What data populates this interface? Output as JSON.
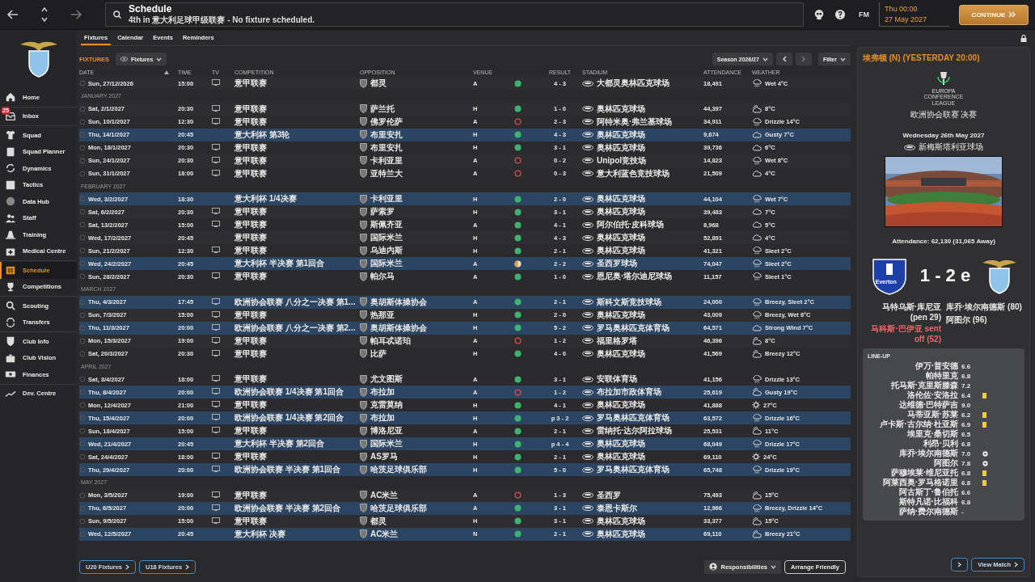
{
  "top_bar": {
    "title": "Schedule",
    "subtitle": "4th in 意大利足球甲级联赛 - No fixture scheduled.",
    "brand": "FM",
    "time": "Thu 00:00",
    "date": "27 May 2027",
    "continue_button": "CONTINUE"
  },
  "sidebar": {
    "groups": [
      {
        "items": [
          {
            "label": "Home",
            "selected": false
          }
        ]
      },
      {
        "items": [
          {
            "label": "Inbox",
            "badge": "25",
            "selected": false
          }
        ]
      },
      {
        "items": [
          {
            "label": "Squad",
            "selected": false
          },
          {
            "label": "Squad Planner",
            "selected": false
          },
          {
            "label": "Dynamics",
            "selected": false
          },
          {
            "label": "Tactics",
            "selected": false
          },
          {
            "label": "Data Hub",
            "selected": false
          },
          {
            "label": "Staff",
            "selected": false
          },
          {
            "label": "Training",
            "selected": false
          },
          {
            "label": "Medical Centre",
            "selected": false
          }
        ]
      },
      {
        "items": [
          {
            "label": "Schedule",
            "selected": true
          },
          {
            "label": "Competitions",
            "selected": false
          }
        ]
      },
      {
        "items": [
          {
            "label": "Scouting",
            "selected": false
          },
          {
            "label": "Transfers",
            "selected": false
          }
        ]
      },
      {
        "items": [
          {
            "label": "Club Info",
            "selected": false
          },
          {
            "label": "Club Vision",
            "selected": false
          },
          {
            "label": "Finances",
            "selected": false
          }
        ]
      },
      {
        "items": [
          {
            "label": "Dev. Centre",
            "selected": false
          }
        ]
      }
    ]
  },
  "tabs": [
    {
      "label": "Fixtures",
      "selected": true
    },
    {
      "label": "Calendar",
      "selected": false
    },
    {
      "label": "Events",
      "selected": false
    },
    {
      "label": "Reminders",
      "selected": false
    }
  ],
  "toolbar": {
    "title": "FIXTURES",
    "view": "Fixtures",
    "season": "Season 2026/27",
    "filter": "Filter"
  },
  "columns": [
    "DATE",
    "TIME",
    "TV",
    "COMPETITION",
    "OPPOSITION",
    "VENUE",
    "RESULT",
    "STADIUM",
    "ATTENDANCE",
    "WEATHER"
  ],
  "rows": [
    {
      "kind": "match",
      "date": "Sun, 27/12/2026",
      "time": "15:00",
      "tv": true,
      "competition": "意甲联赛",
      "opponent": "都灵",
      "venue": "A",
      "result": {
        "kind": "win",
        "score": "4 - 3"
      },
      "stadium": "大都灵奥林匹克球场",
      "attendance": "18,491",
      "weather": {
        "kind": "rain",
        "text": "Wet 4°C"
      },
      "highlighted": false
    },
    {
      "kind": "month",
      "label": "JANUARY 2027"
    },
    {
      "kind": "match",
      "date": "Sat, 2/1/2027",
      "time": "20:30",
      "tv": true,
      "competition": "意甲联赛",
      "opponent": "萨兰托",
      "venue": "H",
      "result": {
        "kind": "win",
        "score": "1 - 0"
      },
      "stadium": "奥林匹克球场",
      "attendance": "44,397",
      "weather": {
        "kind": "partly",
        "text": "8°C"
      },
      "highlighted": false
    },
    {
      "kind": "match",
      "date": "Sun, 10/1/2027",
      "time": "12:30",
      "tv": true,
      "competition": "意甲联赛",
      "opponent": "佛罗伦萨",
      "venue": "A",
      "result": {
        "kind": "loss",
        "score": "2 - 3"
      },
      "stadium": "阿特米奥·弗兰基球场",
      "attendance": "34,911",
      "weather": {
        "kind": "rain",
        "text": "Drizzle 14°C"
      },
      "highlighted": false
    },
    {
      "kind": "match",
      "date": "Thu, 14/1/2027",
      "time": "20:45",
      "tv": false,
      "competition": "意大利杯 第3轮",
      "opponent": "布里安扎",
      "venue": "H",
      "result": {
        "kind": "win",
        "score": "4 - 3"
      },
      "stadium": "奥林匹克球场",
      "attendance": "9,674",
      "weather": {
        "kind": "cloud",
        "text": "Gusty 7°C"
      },
      "highlighted": true
    },
    {
      "kind": "match",
      "date": "Mon, 18/1/2027",
      "time": "20:30",
      "tv": true,
      "competition": "意甲联赛",
      "opponent": "布里安扎",
      "venue": "H",
      "result": {
        "kind": "win",
        "score": "3 - 1"
      },
      "stadium": "奥林匹克球场",
      "attendance": "39,736",
      "weather": {
        "kind": "cloud",
        "text": "6°C"
      },
      "highlighted": false
    },
    {
      "kind": "match",
      "date": "Sun, 24/1/2027",
      "time": "20:30",
      "tv": true,
      "competition": "意甲联赛",
      "opponent": "卡利亚里",
      "venue": "A",
      "result": {
        "kind": "loss",
        "score": "0 - 2"
      },
      "stadium": "Unipol竞技场",
      "attendance": "14,823",
      "weather": {
        "kind": "rain",
        "text": "Wet 8°C"
      },
      "highlighted": false
    },
    {
      "kind": "match",
      "date": "Sun, 31/1/2027",
      "time": "18:00",
      "tv": true,
      "competition": "意甲联赛",
      "opponent": "亚特兰大",
      "venue": "A",
      "result": {
        "kind": "loss",
        "score": "0 - 3"
      },
      "stadium": "意大利蓝色竞技球场",
      "attendance": "21,509",
      "weather": {
        "kind": "cloud",
        "text": "4°C"
      },
      "highlighted": false
    },
    {
      "kind": "month",
      "label": "FEBRUARY 2027"
    },
    {
      "kind": "match",
      "date": "Wed, 3/2/2027",
      "time": "18:30",
      "tv": false,
      "competition": "意大利杯 1/4决赛",
      "opponent": "卡利亚里",
      "venue": "H",
      "result": {
        "kind": "win",
        "score": "2 - 0"
      },
      "stadium": "奥林匹克球场",
      "attendance": "44,104",
      "weather": {
        "kind": "rain",
        "text": "Wet 7°C"
      },
      "highlighted": true
    },
    {
      "kind": "match",
      "date": "Sat, 6/2/2027",
      "time": "20:30",
      "tv": true,
      "competition": "意甲联赛",
      "opponent": "萨索罗",
      "venue": "H",
      "result": {
        "kind": "win",
        "score": "3 - 1"
      },
      "stadium": "奥林匹克球场",
      "attendance": "39,483",
      "weather": {
        "kind": "cloud",
        "text": "7°C"
      },
      "highlighted": false
    },
    {
      "kind": "match",
      "date": "Sat, 13/2/2027",
      "time": "15:00",
      "tv": true,
      "competition": "意甲联赛",
      "opponent": "斯佩齐亚",
      "venue": "A",
      "result": {
        "kind": "win",
        "score": "4 - 1"
      },
      "stadium": "阿尔伯托·皮科球场",
      "attendance": "8,968",
      "weather": {
        "kind": "cloud",
        "text": "5°C"
      },
      "highlighted": false
    },
    {
      "kind": "match",
      "date": "Wed, 17/2/2027",
      "time": "20:45",
      "tv": false,
      "competition": "意甲联赛",
      "opponent": "国际米兰",
      "venue": "H",
      "result": {
        "kind": "win",
        "score": "4 - 3"
      },
      "stadium": "奥林匹克球场",
      "attendance": "52,891",
      "weather": {
        "kind": "cloud",
        "text": "4°C"
      },
      "highlighted": false
    },
    {
      "kind": "match",
      "date": "Sun, 21/2/2027",
      "time": "12:30",
      "tv": true,
      "competition": "意甲联赛",
      "opponent": "乌迪内斯",
      "venue": "H",
      "result": {
        "kind": "win",
        "score": "2 - 1"
      },
      "stadium": "奥林匹克球场",
      "attendance": "41,321",
      "weather": {
        "kind": "rain",
        "text": "Sleet 2°C"
      },
      "highlighted": false
    },
    {
      "kind": "match",
      "date": "Wed, 24/2/2027",
      "time": "20:45",
      "tv": false,
      "competition": "意大利杯 半决赛 第1回合",
      "opponent": "国际米兰",
      "venue": "A",
      "result": {
        "kind": "draw",
        "score": "2 - 2"
      },
      "stadium": "圣西罗球场",
      "attendance": "74,047",
      "weather": {
        "kind": "rain",
        "text": "Sleet 2°C"
      },
      "highlighted": true
    },
    {
      "kind": "match",
      "date": "Sun, 28/2/2027",
      "time": "20:30",
      "tv": true,
      "competition": "意甲联赛",
      "opponent": "帕尔马",
      "venue": "A",
      "result": {
        "kind": "win",
        "score": "1 - 0"
      },
      "stadium": "恩尼奥·塔尔迪尼球场",
      "attendance": "11,157",
      "weather": {
        "kind": "rain",
        "text": "Sleet 1°C"
      },
      "highlighted": false
    },
    {
      "kind": "month",
      "label": "MARCH 2027"
    },
    {
      "kind": "match",
      "date": "Thu, 4/3/2027",
      "time": "17:45",
      "tv": true,
      "competition": "欧洲协会联赛 八分之一决赛 第1...",
      "opponent": "奥胡斯体操协会",
      "venue": "A",
      "result": {
        "kind": "win",
        "score": "2 - 1"
      },
      "stadium": "斯科文斯竞技球场",
      "attendance": "24,000",
      "weather": {
        "kind": "rain",
        "text": "Breezy, Sleet 2°C"
      },
      "highlighted": true
    },
    {
      "kind": "match",
      "date": "Sun, 7/3/2027",
      "time": "15:00",
      "tv": true,
      "competition": "意甲联赛",
      "opponent": "热那亚",
      "venue": "H",
      "result": {
        "kind": "win",
        "score": "2 - 0"
      },
      "stadium": "奥林匹克球场",
      "attendance": "43,009",
      "weather": {
        "kind": "rain",
        "text": "Breezy, Wet 6°C"
      },
      "highlighted": false
    },
    {
      "kind": "match",
      "date": "Thu, 11/3/2027",
      "time": "20:00",
      "tv": true,
      "competition": "欧洲协会联赛 八分之一决赛 第2...",
      "opponent": "奥胡斯体操协会",
      "venue": "H",
      "result": {
        "kind": "win",
        "score": "5 - 2"
      },
      "stadium": "罗马奥林匹克体育场",
      "attendance": "64,571",
      "weather": {
        "kind": "cloud",
        "text": "Strong Wind 7°C"
      },
      "highlighted": true
    },
    {
      "kind": "match",
      "date": "Mon, 15/3/2027",
      "time": "19:00",
      "tv": true,
      "competition": "意甲联赛",
      "opponent": "帕耳忒诺珀",
      "venue": "A",
      "result": {
        "kind": "loss",
        "score": "1 - 2"
      },
      "stadium": "福里格罗塔",
      "attendance": "46,396",
      "weather": {
        "kind": "partly",
        "text": "8°C"
      },
      "highlighted": false
    },
    {
      "kind": "match",
      "date": "Sat, 20/3/2027",
      "time": "20:30",
      "tv": true,
      "competition": "意甲联赛",
      "opponent": "比萨",
      "venue": "H",
      "result": {
        "kind": "win",
        "score": "4 - 0"
      },
      "stadium": "奥林匹克球场",
      "attendance": "41,569",
      "weather": {
        "kind": "partly",
        "text": "Breezy 12°C"
      },
      "highlighted": false
    },
    {
      "kind": "month",
      "label": "APRIL 2027"
    },
    {
      "kind": "match",
      "date": "Sat, 3/4/2027",
      "time": "18:00",
      "tv": true,
      "competition": "意甲联赛",
      "opponent": "尤文图斯",
      "venue": "A",
      "result": {
        "kind": "win",
        "score": "3 - 1"
      },
      "stadium": "安联体育场",
      "attendance": "41,156",
      "weather": {
        "kind": "rain",
        "text": "Drizzle 13°C"
      },
      "highlighted": false
    },
    {
      "kind": "match",
      "date": "Thu, 8/4/2027",
      "time": "20:00",
      "tv": true,
      "competition": "欧洲协会联赛 1/4决赛 第1回合",
      "opponent": "布拉加",
      "venue": "A",
      "result": {
        "kind": "loss",
        "score": "1 - 2"
      },
      "stadium": "布拉加市政体育场",
      "attendance": "25,619",
      "weather": {
        "kind": "partly",
        "text": "Gusty 19°C"
      },
      "highlighted": true
    },
    {
      "kind": "match",
      "date": "Mon, 12/4/2027",
      "time": "21:00",
      "tv": true,
      "competition": "意甲联赛",
      "opponent": "克雷莫纳",
      "venue": "H",
      "result": {
        "kind": "win",
        "score": "4 - 1"
      },
      "stadium": "奥林匹克球场",
      "attendance": "41,888",
      "weather": {
        "kind": "sun",
        "text": "27°C"
      },
      "highlighted": false
    },
    {
      "kind": "match",
      "date": "Thu, 15/4/2027",
      "time": "20:00",
      "tv": true,
      "competition": "欧洲协会联赛 1/4决赛 第2回合",
      "opponent": "布拉加",
      "venue": "H",
      "result": {
        "kind": "win",
        "score": "p 3 - 2"
      },
      "stadium": "罗马奥林匹克体育场",
      "attendance": "63,572",
      "weather": {
        "kind": "rain",
        "text": "Drizzle 16°C"
      },
      "highlighted": true
    },
    {
      "kind": "match",
      "date": "Sun, 18/4/2027",
      "time": "15:00",
      "tv": true,
      "competition": "意甲联赛",
      "opponent": "博洛尼亚",
      "venue": "A",
      "result": {
        "kind": "win",
        "score": "2 - 1"
      },
      "stadium": "雷纳托·达尔阿拉球场",
      "attendance": "25,531",
      "weather": {
        "kind": "partly",
        "text": "11°C"
      },
      "highlighted": false
    },
    {
      "kind": "match",
      "date": "Wed, 21/4/2027",
      "time": "20:45",
      "tv": false,
      "competition": "意大利杯 半决赛 第2回合",
      "opponent": "国际米兰",
      "venue": "H",
      "result": {
        "kind": "win",
        "score": "p 4 - 4"
      },
      "stadium": "奥林匹克球场",
      "attendance": "68,049",
      "weather": {
        "kind": "rain",
        "text": "Drizzle 17°C"
      },
      "highlighted": true
    },
    {
      "kind": "match",
      "date": "Sat, 24/4/2027",
      "time": "18:00",
      "tv": true,
      "competition": "意甲联赛",
      "opponent": "AS罗马",
      "venue": "H",
      "result": {
        "kind": "win",
        "score": "2 - 1"
      },
      "stadium": "奥林匹克球场",
      "attendance": "69,110",
      "weather": {
        "kind": "sun",
        "text": "24°C"
      },
      "highlighted": false
    },
    {
      "kind": "match",
      "date": "Thu, 29/4/2027",
      "time": "20:00",
      "tv": true,
      "competition": "欧洲协会联赛 半决赛 第1回合",
      "opponent": "哈茨足球俱乐部",
      "venue": "H",
      "result": {
        "kind": "win",
        "score": "5 - 0"
      },
      "stadium": "罗马奥林匹克体育场",
      "attendance": "65,748",
      "weather": {
        "kind": "rain",
        "text": "Drizzle 19°C"
      },
      "highlighted": true
    },
    {
      "kind": "month",
      "label": "MAY 2027"
    },
    {
      "kind": "match",
      "date": "Mon, 3/5/2027",
      "time": "19:00",
      "tv": true,
      "competition": "意甲联赛",
      "opponent": "AC米兰",
      "venue": "A",
      "result": {
        "kind": "loss",
        "score": "1 - 3"
      },
      "stadium": "圣西罗",
      "attendance": "75,493",
      "weather": {
        "kind": "partly",
        "text": "15°C"
      },
      "highlighted": false
    },
    {
      "kind": "match",
      "date": "Thu, 6/5/2027",
      "time": "20:00",
      "tv": true,
      "competition": "欧洲协会联赛 半决赛 第2回合",
      "opponent": "哈茨足球俱乐部",
      "venue": "A",
      "result": {
        "kind": "win",
        "score": "3 - 1"
      },
      "stadium": "泰恩卡斯尔",
      "attendance": "12,966",
      "weather": {
        "kind": "rain",
        "text": "Breezy, Drizzle 14°C"
      },
      "highlighted": true
    },
    {
      "kind": "match",
      "date": "Sun, 9/5/2027",
      "time": "15:00",
      "tv": true,
      "competition": "意甲联赛",
      "opponent": "都灵",
      "venue": "H",
      "result": {
        "kind": "win",
        "score": "3 - 1"
      },
      "stadium": "奥林匹克球场",
      "attendance": "33,377",
      "weather": {
        "kind": "partly",
        "text": "15°C"
      },
      "highlighted": false
    },
    {
      "kind": "match",
      "date": "Wed, 12/5/2027",
      "time": "20:45",
      "tv": false,
      "competition": "意大利杯 决赛",
      "opponent": "AC米兰",
      "venue": "N",
      "result": {
        "kind": "win",
        "score": "2 - 1"
      },
      "stadium": "奥林匹克球场",
      "attendance": "69,110",
      "weather": {
        "kind": "partly",
        "text": "Breezy 21°C"
      },
      "highlighted": true
    }
  ],
  "footer": {
    "left_buttons": [
      "U20 Fixtures",
      "U18 Fixtures"
    ],
    "responsibilities": "Responsibilities",
    "arrange_button": "Arrange Friendly"
  },
  "panel": {
    "header": "埃弗顿 (N) (YESTERDAY 20:00)",
    "logo_lines": [
      "EUROPA",
      "CONFERENCE",
      "LEAGUE"
    ],
    "competition": "欧洲协会联赛 决赛",
    "date": "Wednesday 26th May 2027",
    "stadium": "新梅斯塔利亚球场",
    "attendance": "Attendance: 62,130 (31,065 Away)",
    "home_crest_text": "Everton",
    "score": "1 - 2 e",
    "home_events": [
      {
        "text": "马特乌斯·库尼亚 (pen 29)",
        "sent_off": false
      },
      {
        "text": "马科斯·巴伊亚 sent off (52)",
        "sent_off": true
      }
    ],
    "away_events": [
      {
        "text": "库乔·埃尔南德斯 (80)",
        "sent_off": false
      },
      {
        "text": "阿图尔 (96)",
        "sent_off": false
      }
    ],
    "lineup_title": "LINE-UP",
    "lineup": [
      {
        "name": "伊万·普安德",
        "rating": "6.6",
        "kind": "none"
      },
      {
        "name": "帕特里克",
        "rating": "6.8",
        "kind": "none"
      },
      {
        "name": "托马斯·克里斯滕森",
        "rating": "7.2",
        "kind": "none"
      },
      {
        "name": "洛伦佐·安洛拉",
        "rating": "6.4",
        "kind": "booked"
      },
      {
        "name": "达维德·巴特萨吉",
        "rating": "9.0",
        "kind": "none"
      },
      {
        "name": "马蒂亚斯·苏莱",
        "rating": "6.2",
        "kind": "booked"
      },
      {
        "name": "卢卡斯·古尔纳·杜亚斯",
        "rating": "6.9",
        "kind": "booked"
      },
      {
        "name": "埃里克·桑切斯",
        "rating": "6.5",
        "kind": "none"
      },
      {
        "name": "利昂·贝利",
        "rating": "6.8",
        "kind": "none"
      },
      {
        "name": "库乔·埃尔南德斯",
        "rating": "7.0",
        "kind": "goal"
      },
      {
        "name": "阿图尔",
        "rating": "7.8",
        "kind": "goal"
      },
      {
        "name": "萨穆埃莱·维尼亚托",
        "rating": "6.8",
        "kind": "booked"
      },
      {
        "name": "阿莱西奥·罗马格诺里",
        "rating": "6.8",
        "kind": "booked"
      },
      {
        "name": "阿古斯丁·鲁伯托",
        "rating": "6.6",
        "kind": "none"
      },
      {
        "name": "斯特凡诺·比福科",
        "rating": "6.8",
        "kind": "none"
      },
      {
        "name": "萨纳·费尔南德斯",
        "rating": "-",
        "kind": "none"
      }
    ],
    "view_button": "View Match"
  }
}
